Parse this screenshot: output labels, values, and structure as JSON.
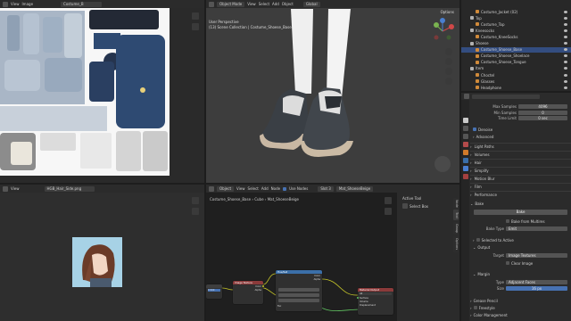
{
  "uv_editor": {
    "view": "View",
    "image": "Image",
    "image_name": "Costume_B"
  },
  "viewport": {
    "mode": "Object Mode",
    "menu": [
      "View",
      "Select",
      "Add",
      "Object"
    ],
    "transform": "Global",
    "options": "Options",
    "perspective": "User Perspective",
    "collection": "(13) Scene Collection | Costume_Shoese_Base"
  },
  "outliner": {
    "items": [
      {
        "name": "Costume_Jacket (02)",
        "indent": 2
      },
      {
        "name": "Top",
        "indent": 1
      },
      {
        "name": "Costume_Top",
        "indent": 2
      },
      {
        "name": "Kneesocks",
        "indent": 1
      },
      {
        "name": "Costume_KneeSocks",
        "indent": 2
      },
      {
        "name": "Shoese",
        "indent": 1
      },
      {
        "name": "Costume_Shoese_Base",
        "indent": 2
      },
      {
        "name": "Costume_Shoese_Shoelace",
        "indent": 2
      },
      {
        "name": "Costume_Shoese_Tongue",
        "indent": 2
      },
      {
        "name": "Item",
        "indent": 1
      },
      {
        "name": "Choctel",
        "indent": 2
      },
      {
        "name": "Glasses",
        "indent": 2
      },
      {
        "name": "Headphone",
        "indent": 2
      }
    ]
  },
  "properties": {
    "max_samples_label": "Max Samples",
    "max_samples_value": "4096",
    "min_samples_label": "Min Samples",
    "min_samples_value": "0",
    "time_limit_label": "Time Limit",
    "time_limit_value": "0 sec",
    "denoise": "Denoise",
    "advanced": "Advanced",
    "sections": [
      "Light Paths",
      "Volumes",
      "Hair",
      "Simplify",
      "Motion Blur",
      "Film",
      "Performance"
    ],
    "bake": "Bake",
    "bake_button": "Bake",
    "bake_from_multires": "Bake from Multires",
    "bake_type_label": "Bake Type",
    "bake_type_value": "Emit",
    "selected_to_active": "Selected to Active",
    "output": "Output",
    "target_label": "Target",
    "target_value": "Image Textures",
    "clear_image": "Clear Image",
    "margin": "Margin",
    "type_label": "Type",
    "type_value": "Adjacent Faces",
    "size_label": "Size",
    "size_value": "16 px",
    "grease_pencil": "Grease Pencil",
    "freestyle": "Freestyle",
    "color_management": "Color Management"
  },
  "image_editor": {
    "view": "View",
    "image_name": "HGB_Hair_Side.png"
  },
  "node_editor": {
    "object": "Object",
    "menu": [
      "View",
      "Select",
      "Add",
      "Node"
    ],
    "use_nodes": "Use Nodes",
    "slot": "Slot 3",
    "material": "Mat_ShoeseBeige",
    "breadcrumb": [
      "Costume_Shoese_Base",
      "Cube",
      "Mat_ShoeseBeige"
    ],
    "active_tool": "Active Tool",
    "select_box": "Select Box",
    "tabs": [
      "Tool",
      "Group",
      "Options",
      "Node"
    ],
    "nodes": {
      "mix": "Mix",
      "image_texture": "Image Texture",
      "hue_sat": "Hue/Sat",
      "material_output": "Material Output",
      "value_label": "0.500",
      "color": "Color",
      "alpha": "Alpha",
      "surface": "Surface",
      "volume": "Volume",
      "displacement": "Displacement",
      "all": "All",
      "fac": "Fac"
    }
  },
  "colors": {
    "accent": "#4772b3",
    "header": "#2b2b2b",
    "area_bg": "#303030",
    "uv_blue": "#2e4a72",
    "node_red": "#8b3a3a",
    "node_blue": "#3b6fa8"
  }
}
